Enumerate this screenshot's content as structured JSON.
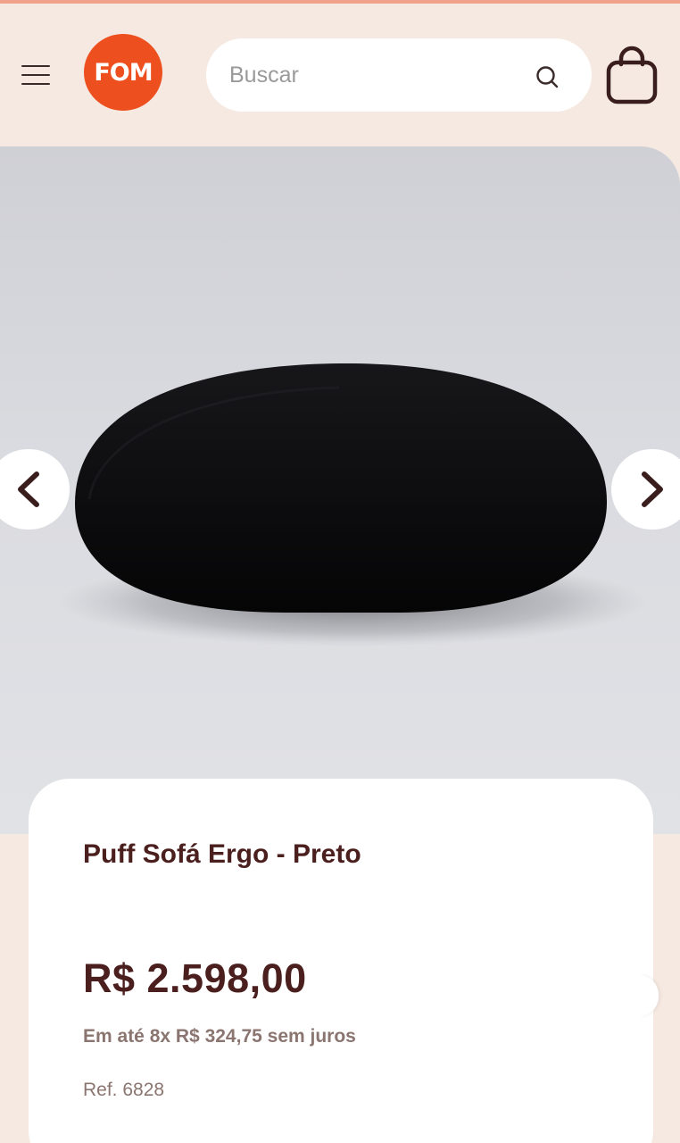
{
  "header": {
    "logo_text": "FOM",
    "search": {
      "placeholder": "Buscar",
      "value": ""
    },
    "icons": {
      "menu": "hamburger-menu-icon",
      "search": "search-icon",
      "cart": "shopping-bag-icon"
    }
  },
  "gallery": {
    "icons": {
      "prev": "chevron-left-icon",
      "next": "chevron-right-icon"
    }
  },
  "product": {
    "title": "Puff Sofá Ergo - Preto",
    "price": "R$ 2.598,00",
    "installments": "Em até 8x R$ 324,75 sem juros",
    "reference": "Ref. 6828"
  },
  "colors": {
    "background": "#f5e9e1",
    "brand": "#ee4f1e",
    "text_primary": "#4a1f1e",
    "text_secondary": "#8a7570"
  }
}
